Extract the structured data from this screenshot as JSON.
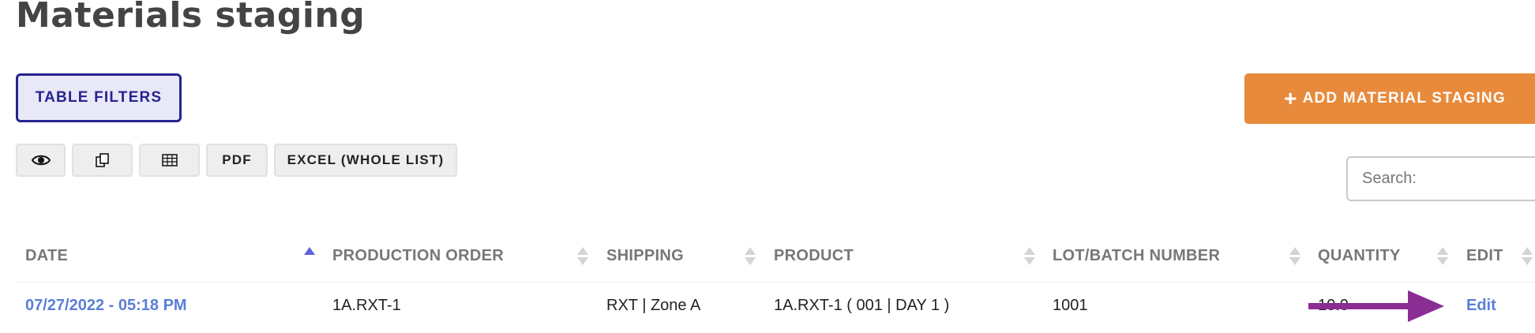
{
  "page": {
    "title": "Materials staging"
  },
  "toolbar": {
    "filters_label": "TABLE FILTERS",
    "add_label": "ADD MATERIAL STAGING",
    "add_icon": "plus-icon",
    "pdf_label": "PDF",
    "excel_label": "EXCEL (WHOLE LIST)",
    "icons": [
      "eye-icon",
      "copy-icon",
      "table-icon"
    ]
  },
  "search": {
    "placeholder": "Search:"
  },
  "table": {
    "columns": [
      "DATE",
      "PRODUCTION ORDER",
      "SHIPPING",
      "PRODUCT",
      "LOT/BATCH NUMBER",
      "QUANTITY",
      "EDIT"
    ],
    "sorted_column": "DATE",
    "sort_direction": "ascending",
    "rows": [
      {
        "date": "07/27/2022 - 05:18 PM",
        "production_order": "1A.RXT-1",
        "shipping": "RXT | Zone A",
        "product": "1A.RXT-1 ( 001 | DAY 1 )",
        "lot": "1001",
        "quantity": "10.0",
        "edit": "Edit"
      }
    ]
  },
  "colors": {
    "filters_border": "#26248f",
    "filters_bg": "#e9e8f7",
    "add_button": "#e88a3b",
    "link": "#5b7fd8",
    "annotation_arrow": "#8a2e94"
  }
}
